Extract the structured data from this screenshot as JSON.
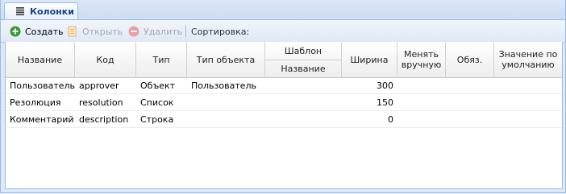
{
  "tab": {
    "label": "Колонки",
    "icon": "list-icon"
  },
  "toolbar": {
    "create_label": "Создать",
    "open_label": "Открыть",
    "delete_label": "Удалить",
    "sort_label": "Сортировка:"
  },
  "columns": {
    "name": "Название",
    "code": "Код",
    "type": "Тип",
    "object_type": "Тип объекта",
    "template": "Шаблон",
    "template_name": "Название",
    "width": "Ширина",
    "manual": "Менять вручную",
    "required": "Обяз.",
    "default": "Значение по умолчанию"
  },
  "rows": [
    {
      "name": "Пользователь",
      "code": "approver",
      "type": "Объект",
      "object_type": "Пользователь",
      "template_name": "",
      "width": "300",
      "manual": "",
      "required": "",
      "default": ""
    },
    {
      "name": "Резолюция",
      "code": "resolution",
      "type": "Список",
      "object_type": "",
      "template_name": "",
      "width": "150",
      "manual": "",
      "required": "",
      "default": ""
    },
    {
      "name": "Комментарий",
      "code": "description",
      "type": "Строка",
      "object_type": "",
      "template_name": "",
      "width": "0",
      "manual": "",
      "required": "",
      "default": ""
    }
  ],
  "colors": {
    "accent": "#15428b",
    "border": "#99bbe8",
    "create_icon": "#3a9a2e",
    "delete_icon": "#e9a0a0"
  }
}
